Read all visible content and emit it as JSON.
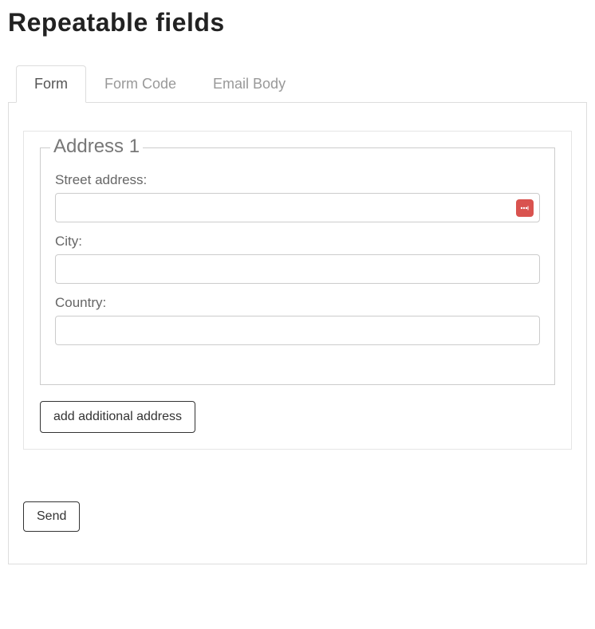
{
  "page": {
    "title": "Repeatable fields"
  },
  "tabs": [
    {
      "label": "Form",
      "active": true
    },
    {
      "label": "Form Code",
      "active": false
    },
    {
      "label": "Email Body",
      "active": false
    }
  ],
  "form": {
    "fieldset": {
      "legend": "Address 1",
      "fields": {
        "street": {
          "label": "Street address:",
          "value": ""
        },
        "city": {
          "label": "City:",
          "value": ""
        },
        "country": {
          "label": "Country:",
          "value": ""
        }
      }
    },
    "add_button": "add additional address",
    "send_button": "Send"
  }
}
